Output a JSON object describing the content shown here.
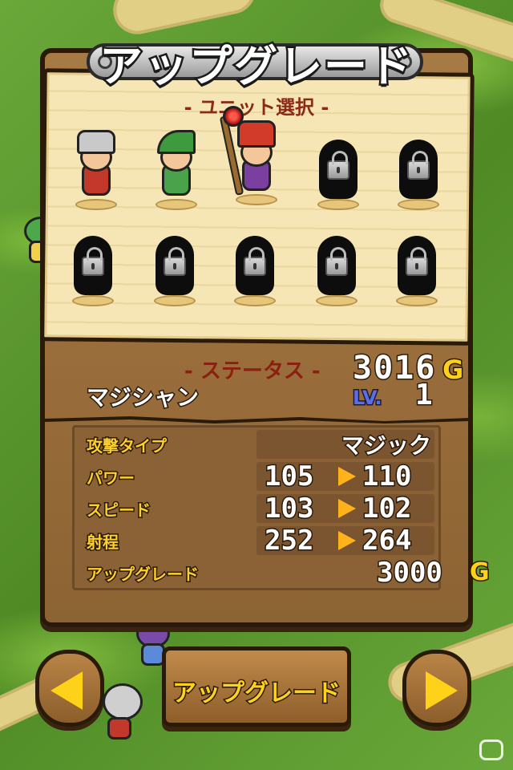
{
  "title": "アップグレード",
  "unit_select": {
    "heading": "- ユニット選択 -",
    "units": [
      {
        "kind": "knight",
        "locked": false
      },
      {
        "kind": "archer",
        "locked": false
      },
      {
        "kind": "mage",
        "locked": false,
        "selected": true
      },
      {
        "kind": "locked",
        "locked": true
      },
      {
        "kind": "locked",
        "locked": true
      },
      {
        "kind": "locked",
        "locked": true
      },
      {
        "kind": "locked",
        "locked": true
      },
      {
        "kind": "locked",
        "locked": true
      },
      {
        "kind": "locked",
        "locked": true
      },
      {
        "kind": "locked",
        "locked": true
      }
    ]
  },
  "status": {
    "heading": "- ステータス -",
    "gold": "3016",
    "gold_unit": "G",
    "unit_name": "マジシャン",
    "level_label": "LV.",
    "level": "1"
  },
  "stats": {
    "attack_type": {
      "label": "攻撃タイプ",
      "value": "マジック"
    },
    "power": {
      "label": "パワー",
      "from": "105",
      "to": "110"
    },
    "speed": {
      "label": "スピード",
      "from": "103",
      "to": "102"
    },
    "range": {
      "label": "射程",
      "from": "252",
      "to": "264"
    },
    "upgrade_cost": {
      "label": "アップグレード",
      "value": "3000",
      "unit": "G"
    }
  },
  "buttons": {
    "upgrade_label": "アップグレード",
    "prev_icon": "left-arrow-icon",
    "next_icon": "right-arrow-icon"
  },
  "colors": {
    "accent_gold": "#ffd21a",
    "stat_label": "#ffcf2a",
    "heading_red": "#8b1f10",
    "level_blue": "#5a6ee6"
  }
}
